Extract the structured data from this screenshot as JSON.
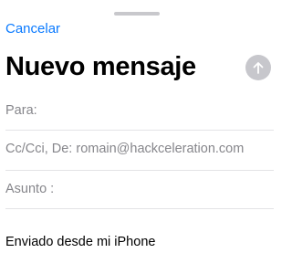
{
  "header": {
    "cancel_label": "Cancelar",
    "title": "Nuevo mensaje",
    "send_icon": "arrow-up-icon"
  },
  "fields": {
    "to_label": "Para:",
    "cc_label": "Cc/Cci, De:",
    "cc_value": "romain@hackceleration.com",
    "subject_label": "Asunto :"
  },
  "body": {
    "signature": "Enviado desde mi iPhone"
  },
  "colors": {
    "accent": "#0a7aff",
    "send_button_disabled": "#c7c7cc",
    "secondary_text": "#86868b"
  }
}
